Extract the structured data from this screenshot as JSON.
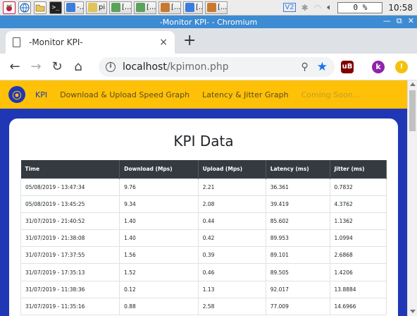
{
  "taskbar": {
    "tasks": [
      {
        "label": "-...",
        "color": "#3b7ddd"
      },
      {
        "label": "pi",
        "color": "#e0c45a"
      },
      {
        "label": "[...",
        "color": "#5aa35a"
      },
      {
        "label": "[...",
        "color": "#5aa35a"
      },
      {
        "label": "[...",
        "color": "#c77a2f"
      },
      {
        "label": "[...",
        "color": "#3b7ddd"
      },
      {
        "label": "[...",
        "color": "#c77a2f"
      }
    ],
    "cpu": "0 %",
    "clock": "10:58"
  },
  "window": {
    "title": "-Monitor KPI- - Chromium",
    "tab_title": "-Monitor KPI-",
    "tab_close": "×",
    "new_tab": "+"
  },
  "toolbar": {
    "url_host": "localhost",
    "url_path": "/kpimon.php",
    "profile_initial": "k"
  },
  "nav": {
    "links": [
      {
        "label": "KPI",
        "state": "active"
      },
      {
        "label": "Download & Upload Speed Graph",
        "state": "normal"
      },
      {
        "label": "Latency & Jitter Graph",
        "state": "normal"
      },
      {
        "label": "Coming Soon...",
        "state": "disabled"
      }
    ]
  },
  "main": {
    "heading": "KPI Data",
    "table": {
      "columns": [
        "Time",
        "Download (Mps)",
        "Upload (Mps)",
        "Latency (ms)",
        "Jitter (ms)"
      ],
      "rows": [
        [
          "05/08/2019 - 13:47:34",
          "9.76",
          "2.21",
          "36.361",
          "0.7832"
        ],
        [
          "05/08/2019 - 13:45:25",
          "9.34",
          "2.08",
          "39.419",
          "4.3762"
        ],
        [
          "31/07/2019 - 21:40:52",
          "1.40",
          "0.44",
          "85.602",
          "1.1362"
        ],
        [
          "31/07/2019 - 21:38:08",
          "1.40",
          "0.42",
          "89.953",
          "1.0994"
        ],
        [
          "31/07/2019 - 17:37:55",
          "1.56",
          "0.39",
          "89.101",
          "2.6868"
        ],
        [
          "31/07/2019 - 17:35:13",
          "1.52",
          "0.46",
          "89.505",
          "1.4206"
        ],
        [
          "31/07/2019 - 11:38:36",
          "0.12",
          "1.13",
          "92.017",
          "13.8884"
        ],
        [
          "31/07/2019 - 11:35:16",
          "0.88",
          "2.58",
          "77.009",
          "14.6966"
        ]
      ]
    }
  }
}
